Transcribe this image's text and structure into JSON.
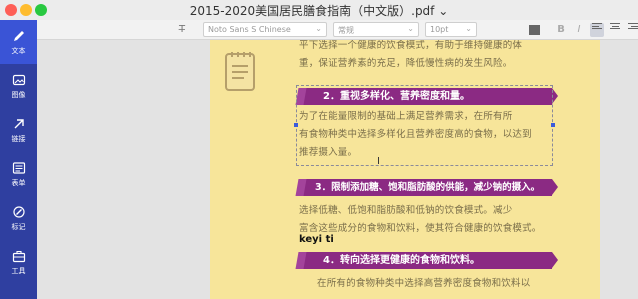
{
  "window": {
    "title": "2015-2020美国居民膳食指南（中文版）.pdf ⌄"
  },
  "sidebar": {
    "items": [
      {
        "label": "文本",
        "icon": "pencil-icon",
        "active": true
      },
      {
        "label": "图像",
        "icon": "image-icon",
        "active": false
      },
      {
        "label": "链接",
        "icon": "link-icon",
        "active": false
      },
      {
        "label": "表单",
        "icon": "form-icon",
        "active": false
      },
      {
        "label": "标记",
        "icon": "marker-icon",
        "active": false
      },
      {
        "label": "工具",
        "icon": "toolbox-icon",
        "active": false
      }
    ]
  },
  "toolbar": {
    "font_family": "Noto Sans S Chinese",
    "font_style": "常规",
    "font_size": "10pt",
    "bold": "B",
    "italic": "I",
    "text_color": "#666666"
  },
  "document": {
    "para_top": "平下选择一个健康的饮食模式，有助于维持健康的体\n重，保证营养素的充足，降低慢性病的发生风险。",
    "heading_2": "2．重视多样化、营养密度和量。",
    "para_2": "为了在能量限制的基础上满足营养需求，在所有所\n有食物种类中选择多样化且营养密度高的食物，以达到\n推荐摄入量。",
    "heading_3": "3．限制添加糖、饱和脂肪酸的供能，减少钠的摄入。",
    "para_3": "选择低糖、低饱和脂肪酸和低钠的饮食模式。减少\n富含这些成分的食物和饮料，使其符合健康的饮食模式。",
    "overlay_text": "keyi ti",
    "heading_4": "4．转向选择更健康的食物和饮料。",
    "para_4": "在所有的食物种类中选择高营养密度食物和饮料以"
  },
  "colors": {
    "sidebar_bg": "#2f3fa0",
    "sidebar_active": "#3a54d6",
    "page_bg": "#f7e59a",
    "banner": "#8b2a83",
    "body_text": "#7a6e4a"
  }
}
